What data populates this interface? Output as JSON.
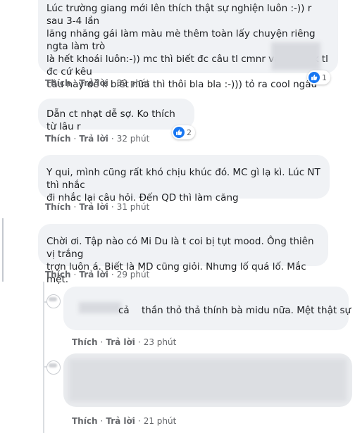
{
  "comments": [
    {
      "text": "Lúc trường giang mới lên thích thật sự nghiện luôn :-)) r sau 3-4 lần\nlăng nhăng gái làm màu mè thêm toàn lấy chuyện riêng ngta làm trò\nlà hết khoái luôn:-)) mc thì biết đc câu tl cmnr vậy ngta k tl đc cứ kêu\ncâu này dễ k biết nữa thì thôi bla bla :-))) tỏ ra cool ngầu",
      "like_label": "Thích",
      "reply_label": "Trả lời",
      "time": "32 phút",
      "reactions": "1"
    },
    {
      "text": "Dẫn ct nhạt dễ sợ. Ko thích từ lâu r",
      "like_label": "Thích",
      "reply_label": "Trả lời",
      "time": "32 phút",
      "reactions": "2"
    },
    {
      "text": "Y qui, mình cũng rất khó chịu khúc đó. MC gì lạ kì. Lúc NT thì nhắc\nđi nhắc lại câu hỏi. Đến QD thì làm căng",
      "like_label": "Thích",
      "reply_label": "Trả lời",
      "time": "31 phút"
    },
    {
      "text": "Chời ơi. Tập nào có Mi Du là t coi bị tụt mood. Ông thiên vị trắng\ntrợn luôn á. Biết là MD cũng giỏi. Nhưng lố quá lố. Mắc mệt.",
      "like_label": "Thích",
      "reply_label": "Trả lời",
      "time": "29 phút"
    }
  ],
  "replies": [
    {
      "name_fragment": "cả",
      "text": "thần thỏ thả thính bà midu nữa. Mệt thật sự",
      "like_label": "Thích",
      "reply_label": "Trả lời",
      "time": "23 phút"
    },
    {
      "like_label": "Thích",
      "reply_label": "Trả lời",
      "time": "21 phút"
    }
  ],
  "separator": "·",
  "colors": {
    "bubble": "#f0f2f5",
    "meta_text": "#65676b",
    "like_blue": "#1877f2"
  },
  "icons": {
    "reaction": "like-thumb-icon",
    "avatar": "user-avatar"
  }
}
